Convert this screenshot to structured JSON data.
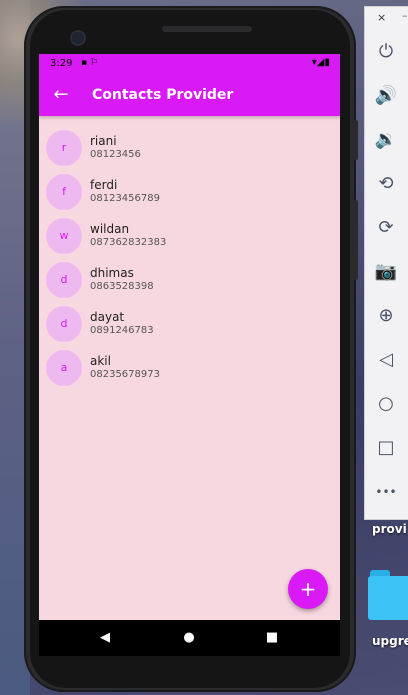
{
  "status_bar": {
    "time": "3:29",
    "left_icons": "▪ ⚐",
    "right_icons": "▾◢▮"
  },
  "app_bar": {
    "title": "Contacts Provider",
    "back_glyph": "←"
  },
  "contacts": [
    {
      "initial": "r",
      "name": "riani",
      "phone": "08123456"
    },
    {
      "initial": "f",
      "name": "ferdi",
      "phone": "08123456789"
    },
    {
      "initial": "w",
      "name": "wildan",
      "phone": "087362832383"
    },
    {
      "initial": "d",
      "name": "dhimas",
      "phone": "0863528398"
    },
    {
      "initial": "d",
      "name": "dayat",
      "phone": "0891246783"
    },
    {
      "initial": "a",
      "name": "akil",
      "phone": "08235678973"
    }
  ],
  "fab": {
    "glyph": "+",
    "icon": "add-icon"
  },
  "nav_bar": {
    "back_glyph": "◀",
    "home_glyph": "●",
    "recents_glyph": "■"
  },
  "emulator_toolbar": {
    "close_glyph": "×",
    "minimize_glyph": "–",
    "buttons": [
      {
        "icon": "power-icon",
        "glyph": "⏻"
      },
      {
        "icon": "volume-up-icon",
        "glyph": "🔊"
      },
      {
        "icon": "volume-down-icon",
        "glyph": "🔉"
      },
      {
        "icon": "rotate-left-icon",
        "glyph": "⟲"
      },
      {
        "icon": "rotate-right-icon",
        "glyph": "⟳"
      },
      {
        "icon": "camera-icon",
        "glyph": "📷"
      },
      {
        "icon": "zoom-icon",
        "glyph": "⊕"
      },
      {
        "icon": "back-icon",
        "glyph": "◁"
      },
      {
        "icon": "home-icon",
        "glyph": "○"
      },
      {
        "icon": "overview-icon",
        "glyph": "□"
      },
      {
        "icon": "more-icon",
        "glyph": "•••"
      }
    ]
  },
  "desktop": {
    "label_1": "provi",
    "label_2": "upgre"
  },
  "colors": {
    "accent": "#d91af7",
    "screen_bg": "#f8d8e0",
    "avatar_bg": "#eeb8f0"
  }
}
